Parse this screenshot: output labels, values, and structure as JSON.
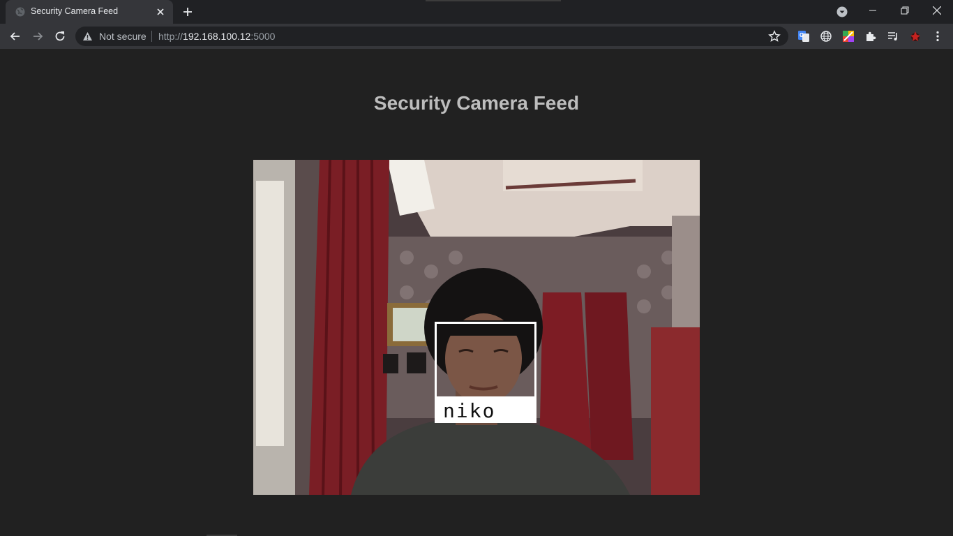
{
  "browser": {
    "tab": {
      "title": "Security Camera Feed"
    },
    "omnibox": {
      "security_label": "Not secure",
      "url_scheme": "http://",
      "url_host": "192.168.100.12",
      "url_port": ":5000"
    }
  },
  "page": {
    "heading": "Security Camera Feed",
    "detection": {
      "label": "niko"
    }
  }
}
